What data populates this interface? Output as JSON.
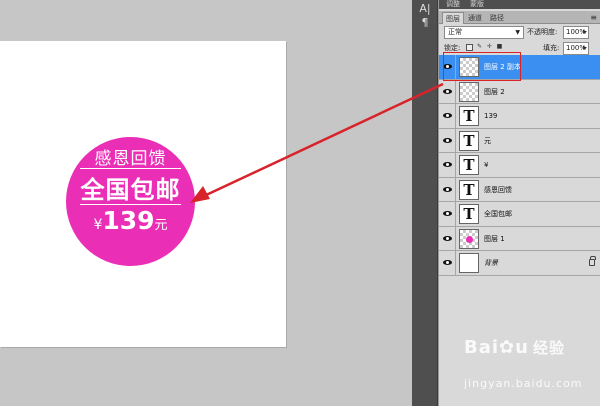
{
  "badge": {
    "line1": "感恩回馈",
    "line2": "全国包邮",
    "currency": "¥",
    "amount": "139",
    "unit": "元",
    "color": "#ea2fb6"
  },
  "tool_strip": {
    "icons": [
      "character-icon",
      "paragraph-icon"
    ],
    "glyphs": [
      "A|",
      "¶"
    ]
  },
  "panel": {
    "top_tabs": [
      "调整",
      "蒙版"
    ],
    "tabs": [
      "图层",
      "通道",
      "路径"
    ],
    "active_tab": "图层",
    "blend_mode": "正常",
    "opacity_label": "不透明度:",
    "opacity_value": "100%",
    "lock_label": "锁定:",
    "fill_label": "填充:",
    "fill_value": "100%",
    "selected_color": "#3b8ff0"
  },
  "layers": [
    {
      "name": "图层 2 副本",
      "type": "pixel",
      "selected": true
    },
    {
      "name": "图层 2",
      "type": "pixel",
      "selected": false
    },
    {
      "name": "139",
      "type": "text",
      "selected": false
    },
    {
      "name": "元",
      "type": "text",
      "selected": false
    },
    {
      "name": "¥",
      "type": "text",
      "selected": false
    },
    {
      "name": "感恩回馈",
      "type": "text",
      "selected": false
    },
    {
      "name": "全国包邮",
      "type": "text",
      "selected": false
    },
    {
      "name": "图层 1",
      "type": "shape",
      "selected": false
    },
    {
      "name": "背景",
      "type": "background",
      "selected": false,
      "locked": true
    }
  ],
  "watermark": {
    "logo": "Bai",
    "logo_tail": "u",
    "logo_cn": "经验",
    "sub": "jingyan.baidu.com"
  },
  "annotation_color": "#d8232a"
}
